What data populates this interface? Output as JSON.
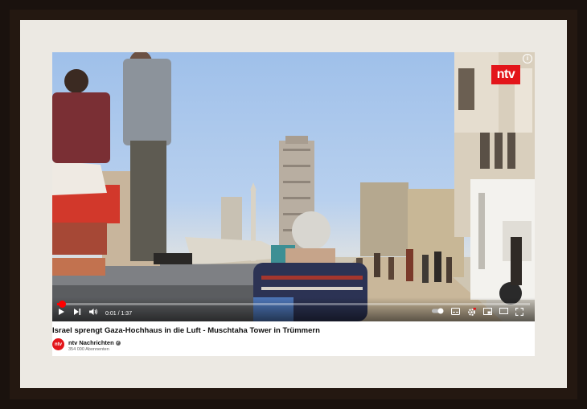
{
  "player": {
    "logo_text": "ntv",
    "info_icon": "info-icon",
    "time_current": "0:01",
    "time_separator": " / ",
    "time_total": "1:37",
    "progress": 0.01,
    "accent": "#ff0000",
    "controls": [
      "play-icon",
      "next-icon",
      "volume-icon",
      "autoplay-toggle-icon",
      "subtitles-icon",
      "settings-icon",
      "miniplayer-icon",
      "theater-icon",
      "cast-icon",
      "fullscreen-icon"
    ]
  },
  "video_info": {
    "title": "Israel sprengt Gaza-Hochhaus in die Luft - Muschtaha Tower in Trümmern",
    "channel_avatar_text": "ntv",
    "channel_name": "ntv Nachrichten",
    "subscribers": "354 000 Abonnenten"
  },
  "colors": {
    "brand": "#e3151a",
    "frame": "#241811",
    "mat": "#ece9e3"
  }
}
